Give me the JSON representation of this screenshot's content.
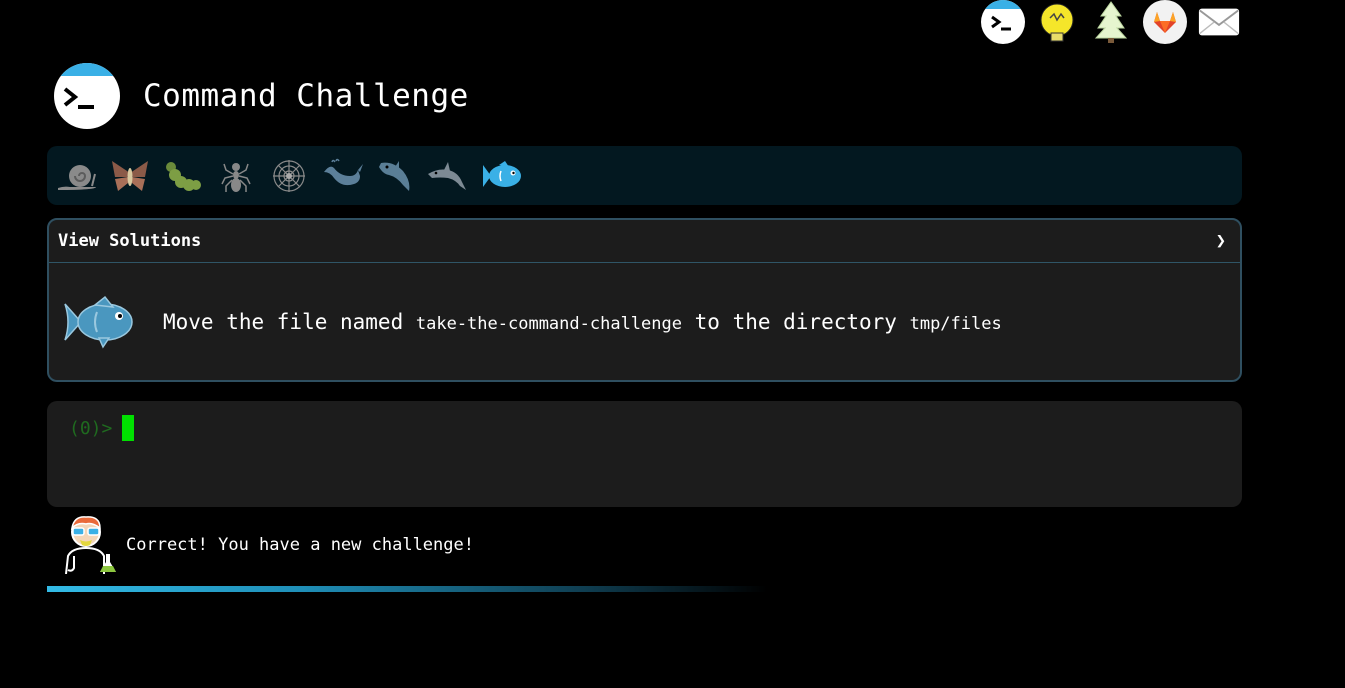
{
  "top_nav": {
    "icons": [
      {
        "name": "terminal-icon"
      },
      {
        "name": "lightbulb-icon"
      },
      {
        "name": "tree-icon"
      },
      {
        "name": "gitlab-icon"
      },
      {
        "name": "mail-icon"
      }
    ]
  },
  "header": {
    "title": "Command Challenge",
    "logo_icon": "terminal-logo-icon"
  },
  "levels": [
    {
      "name": "snail-icon"
    },
    {
      "name": "moth-icon"
    },
    {
      "name": "caterpillar-icon"
    },
    {
      "name": "ant-icon"
    },
    {
      "name": "spider-icon"
    },
    {
      "name": "whale-icon"
    },
    {
      "name": "shark-icon"
    },
    {
      "name": "dolphin-icon"
    },
    {
      "name": "fish-icon",
      "active": true
    }
  ],
  "challenge": {
    "solutions_label": "View Solutions",
    "solutions_chevron": "❯",
    "task_prefix": "Move the file named",
    "task_file": "take-the-command-challenge",
    "task_middle": "to the directory",
    "task_dir": "tmp/files"
  },
  "terminal": {
    "prompt": "(0)>"
  },
  "feedback": {
    "message": "Correct! You have a new challenge!"
  },
  "colors": {
    "accent": "#33bbe6",
    "cursor": "#00e000",
    "prompt": "#1f6a1f",
    "panel": "#1c1c1c",
    "levels_bg": "#031820"
  }
}
